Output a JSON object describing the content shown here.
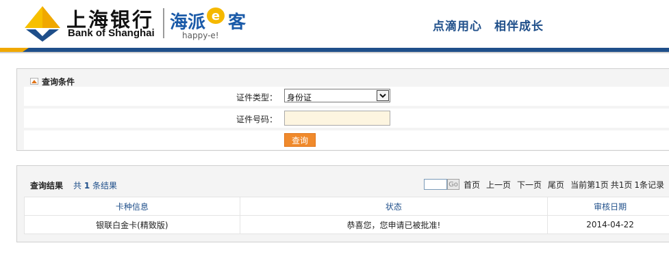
{
  "header": {
    "bank_name_cn": "上海银行",
    "bank_name_en": "Bank of Shanghai",
    "brand_cn_part1": "海派",
    "brand_e": "e",
    "brand_cn_part2": "客",
    "brand_en": "happy-e!",
    "slogan": "点滴用心　相伴成长",
    "logo_icon": "bank-of-shanghai-logo-icon",
    "colors": {
      "brand_blue": "#1f4f8a",
      "brand_gold": "#f0a800",
      "brand_orange": "#f08a2c"
    }
  },
  "query": {
    "title": "查询条件",
    "collapse_icon": "collapse-up-icon",
    "id_type_label": "证件类型：",
    "id_type_value": "身份证",
    "id_number_label": "证件号码：",
    "id_number_value": "",
    "submit_label": "查询"
  },
  "results": {
    "title": "查询结果",
    "count_prefix": "共",
    "count": "1",
    "count_suffix": "条结果",
    "pager": {
      "page_input": "",
      "go_label": "Go",
      "first": "首页",
      "prev": "上一页",
      "next": "下一页",
      "last": "尾页",
      "current": "当前第1页",
      "total_pages": "共1页",
      "total_records": "1条记录"
    },
    "columns": [
      "卡种信息",
      "状态",
      "审核日期"
    ],
    "rows": [
      [
        "银联白金卡(精致版)",
        "恭喜您，您申请已被批准!",
        "2014-04-22"
      ]
    ]
  }
}
